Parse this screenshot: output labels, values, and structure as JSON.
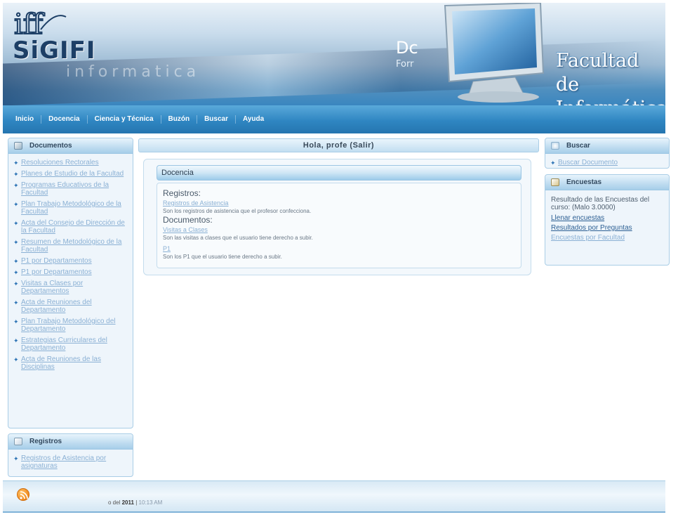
{
  "banner": {
    "logo_text": "SiGIFI",
    "background_word": "informatica",
    "headline_partial": "Dc",
    "subline_partial": "Forr",
    "faculty_title_line1": "Facultad de",
    "faculty_title_line2": "Informática"
  },
  "nav": {
    "items": [
      "Inicio",
      "Docencia",
      "Ciencia y Técnica",
      "Buzón",
      "Buscar",
      "Ayuda"
    ]
  },
  "left": {
    "documentos_title": "Documentos",
    "documentos_links": [
      "Resoluciones Rectorales",
      "Planes de Estudio de la Facultad",
      "Programas Educativos de la Facultad",
      "Plan Trabajo Metodológico de la Facultad",
      "Acta del Consejo de Dirección de la Facultad",
      "Resumen de Metodológico de la Facultad",
      "P1 por Departamentos",
      "P1 por Departamentos",
      "Visitas a Clases por Departamentos",
      "Acta de Reuniones del Departamento",
      "Plan Trabajo Metodológico del Departamento",
      "Estrategias Curriculares del Departamento",
      "Acta de Reuniones de las Disciplinas"
    ],
    "registros_title": "Registros",
    "registros_links": [
      "Registros de Asistencia por asignaturas"
    ]
  },
  "center": {
    "hello_prefix": "Hola, profe",
    "salir_label": "(Salir)",
    "docencia_title": "Docencia",
    "registros_label": "Registros:",
    "registro_link": "Registros de Asistencia",
    "registro_desc": "Son los registros de asistencia que el profesor confecciona.",
    "documentos_label": "Documentos:",
    "visitas_link": "Visitas a Clases",
    "visitas_desc": "Son las visitas a clases que el usuario tiene derecho a subir.",
    "p1_link": "P1",
    "p1_desc": "Son los P1 que el usuario tiene derecho a subir."
  },
  "right": {
    "buscar_title": "Buscar",
    "buscar_link": "Buscar Documento",
    "encuestas_title": "Encuestas",
    "encuestas_text": "Resultado de las Encuestas del curso: (Malo 3.0000)",
    "llenar_link": "Llenar encuestas",
    "resultados_link": "Resultados por Preguntas",
    "facultad_link": "Encuestas por Facultad"
  },
  "footer": {
    "prefix": "o del",
    "year": "2011",
    "time": "10:13 AM"
  },
  "colors": {
    "nav_blue": "#2f86c2",
    "link_light": "#8ab0d4",
    "link_dark": "#2c5f93",
    "header_bg": "#bfdcf0"
  }
}
